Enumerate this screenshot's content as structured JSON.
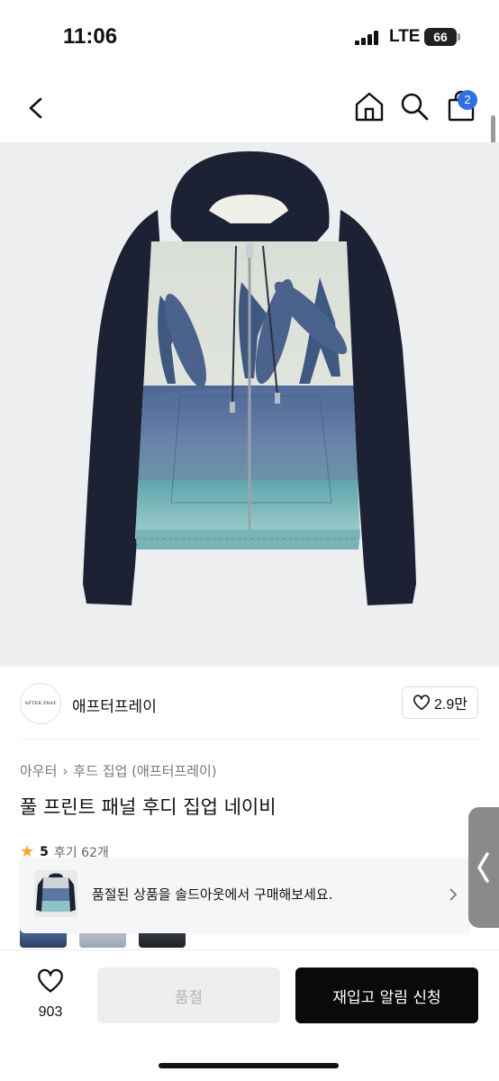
{
  "status_bar": {
    "time": "11:06",
    "network": "LTE",
    "battery": "66"
  },
  "nav": {
    "bag_count": "2"
  },
  "brand": {
    "logo_text": "AFTER PRAY",
    "name": "애프터프레이",
    "likes": "2.9만"
  },
  "breadcrumb": {
    "category": "아우터",
    "sub": "후드 집업 (애프터프레이)"
  },
  "product": {
    "title": "풀 프린트 패널 후디 집업 네이비"
  },
  "rating": {
    "score": "5",
    "reviews": "후기 62개"
  },
  "soldout_banner": {
    "text": "품절된 상품을 솔드아웃에서 구매해보세요."
  },
  "bottom": {
    "wish_count": "903",
    "soldout_label": "품절",
    "restock_label": "재입고 알림 신청"
  },
  "colors": {
    "accent_blue": "#2f6fe0",
    "primary_black": "#0a0a0a",
    "hoodie_navy": "#1c2233"
  }
}
